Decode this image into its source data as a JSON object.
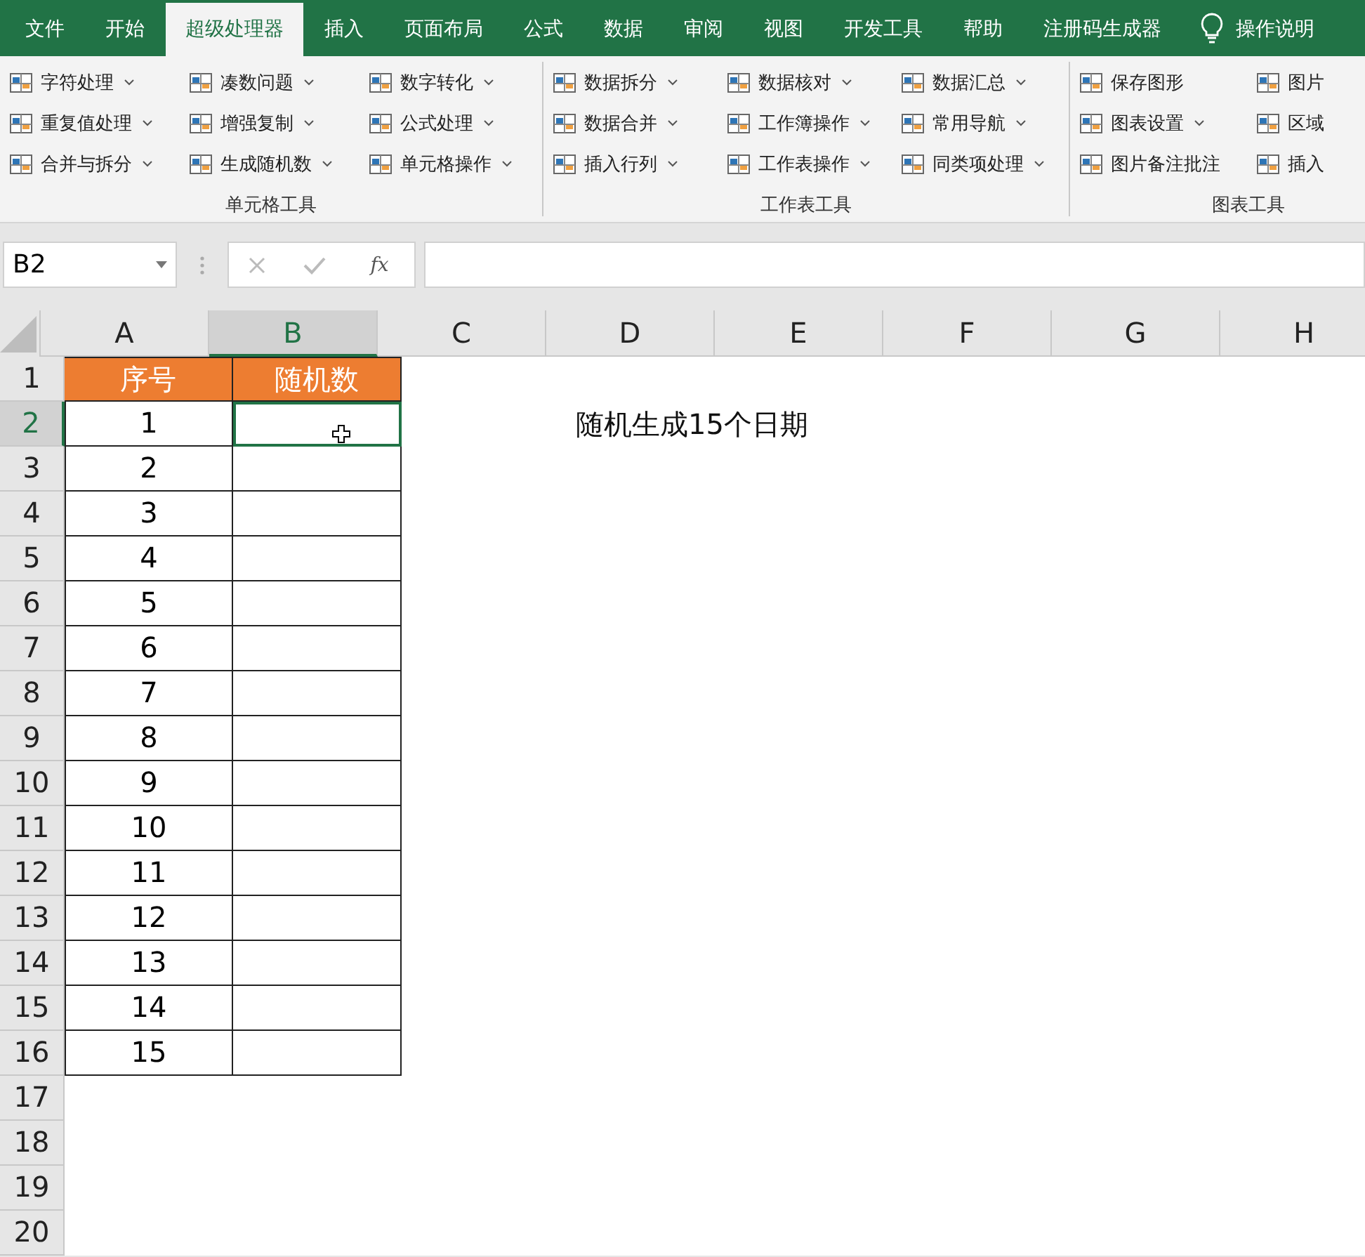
{
  "tabs": [
    {
      "label": "文件",
      "selected": false
    },
    {
      "label": "开始",
      "selected": false
    },
    {
      "label": "超级处理器",
      "selected": true
    },
    {
      "label": "插入",
      "selected": false
    },
    {
      "label": "页面布局",
      "selected": false
    },
    {
      "label": "公式",
      "selected": false
    },
    {
      "label": "数据",
      "selected": false
    },
    {
      "label": "审阅",
      "selected": false
    },
    {
      "label": "视图",
      "selected": false
    },
    {
      "label": "开发工具",
      "selected": false
    },
    {
      "label": "帮助",
      "selected": false
    },
    {
      "label": "注册码生成器",
      "selected": false
    }
  ],
  "tell_me": {
    "label": "操作说明"
  },
  "ribbon_groups": [
    {
      "label": "单元格工具",
      "columns": [
        [
          {
            "label": "字符处理",
            "dropdown": true
          },
          {
            "label": "重复值处理",
            "dropdown": true
          },
          {
            "label": "合并与拆分",
            "dropdown": true
          }
        ],
        [
          {
            "label": "凑数问题",
            "dropdown": true
          },
          {
            "label": "增强复制",
            "dropdown": true
          },
          {
            "label": "生成随机数",
            "dropdown": true
          }
        ],
        [
          {
            "label": "数字转化",
            "dropdown": true
          },
          {
            "label": "公式处理",
            "dropdown": true
          },
          {
            "label": "单元格操作",
            "dropdown": true
          }
        ]
      ]
    },
    {
      "label": "工作表工具",
      "columns": [
        [
          {
            "label": "数据拆分",
            "dropdown": true
          },
          {
            "label": "数据合并",
            "dropdown": true
          },
          {
            "label": "插入行列",
            "dropdown": true
          }
        ],
        [
          {
            "label": "数据核对",
            "dropdown": true
          },
          {
            "label": "工作簿操作",
            "dropdown": true
          },
          {
            "label": "工作表操作",
            "dropdown": true
          }
        ],
        [
          {
            "label": "数据汇总",
            "dropdown": true
          },
          {
            "label": "常用导航",
            "dropdown": true
          },
          {
            "label": "同类项处理",
            "dropdown": true
          }
        ]
      ]
    },
    {
      "label": "图表工具",
      "columns": [
        [
          {
            "label": "保存图形",
            "dropdown": false
          },
          {
            "label": "图表设置",
            "dropdown": true
          },
          {
            "label": "图片备注批注",
            "dropdown": false
          }
        ],
        [
          {
            "label": "图片",
            "dropdown": false
          },
          {
            "label": "区域",
            "dropdown": false
          },
          {
            "label": "插入",
            "dropdown": false
          }
        ]
      ]
    }
  ],
  "name_box": {
    "value": "B2"
  },
  "formula_bar": {
    "fx": "fx"
  },
  "columns": [
    {
      "label": "A",
      "selected": false
    },
    {
      "label": "B",
      "selected": true
    },
    {
      "label": "C",
      "selected": false
    },
    {
      "label": "D",
      "selected": false
    },
    {
      "label": "E",
      "selected": false
    },
    {
      "label": "F",
      "selected": false
    },
    {
      "label": "G",
      "selected": false
    },
    {
      "label": "H",
      "selected": false
    }
  ],
  "rows": [
    {
      "label": "1",
      "kind": "header",
      "selected": false,
      "a": "序号",
      "b": "随机数"
    },
    {
      "label": "2",
      "kind": "data",
      "selected": true,
      "a": "1",
      "note": "随机生成15个日期"
    },
    {
      "label": "3",
      "kind": "data",
      "selected": false,
      "a": "2"
    },
    {
      "label": "4",
      "kind": "data",
      "selected": false,
      "a": "3"
    },
    {
      "label": "5",
      "kind": "data",
      "selected": false,
      "a": "4"
    },
    {
      "label": "6",
      "kind": "data",
      "selected": false,
      "a": "5"
    },
    {
      "label": "7",
      "kind": "data",
      "selected": false,
      "a": "6"
    },
    {
      "label": "8",
      "kind": "data",
      "selected": false,
      "a": "7"
    },
    {
      "label": "9",
      "kind": "data",
      "selected": false,
      "a": "8"
    },
    {
      "label": "10",
      "kind": "data",
      "selected": false,
      "a": "9"
    },
    {
      "label": "11",
      "kind": "data",
      "selected": false,
      "a": "10"
    },
    {
      "label": "12",
      "kind": "data",
      "selected": false,
      "a": "11"
    },
    {
      "label": "13",
      "kind": "data",
      "selected": false,
      "a": "12"
    },
    {
      "label": "14",
      "kind": "data",
      "selected": false,
      "a": "13"
    },
    {
      "label": "15",
      "kind": "data",
      "selected": false,
      "a": "14"
    },
    {
      "label": "16",
      "kind": "data",
      "selected": false,
      "a": "15"
    },
    {
      "label": "17",
      "kind": "blank",
      "selected": false
    },
    {
      "label": "18",
      "kind": "blank",
      "selected": false
    },
    {
      "label": "19",
      "kind": "blank",
      "selected": false
    },
    {
      "label": "20",
      "kind": "blank",
      "selected": false
    }
  ]
}
